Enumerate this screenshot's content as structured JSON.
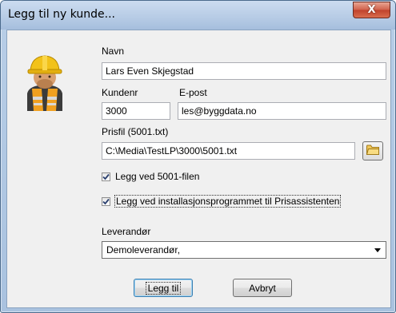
{
  "window": {
    "title": "Legg til ny kunde...",
    "close_label": "X"
  },
  "form": {
    "navn_label": "Navn",
    "navn_value": "Lars Even Skjegstad",
    "kundenr_label": "Kundenr",
    "kundenr_value": "3000",
    "epost_label": "E-post",
    "epost_value": "les@byggdata.no",
    "prisfil_label": "Prisfil (5001.txt)",
    "prisfil_value": "C:\\Media\\TestLP\\3000\\5001.txt",
    "checkbox1_label": "Legg ved 5001-filen",
    "checkbox1_checked": true,
    "checkbox2_label": "Legg ved installasjonsprogrammet til Prisassistenten",
    "checkbox2_checked": true,
    "leverandor_label": "Leverandør",
    "leverandor_value": "Demoleverandør,"
  },
  "buttons": {
    "ok_label": "Legg til",
    "cancel_label": "Avbryt"
  },
  "icons": {
    "avatar": "construction-worker-icon",
    "folder": "folder-icon",
    "dropdown": "chevron-down-icon"
  }
}
